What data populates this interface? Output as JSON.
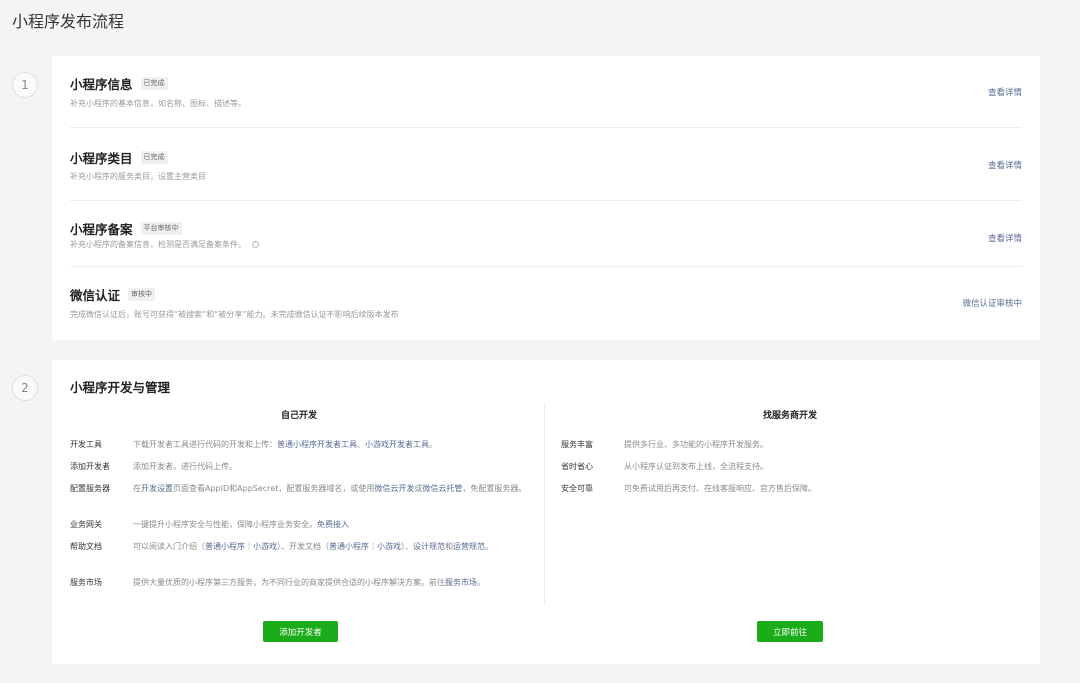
{
  "page_title": "小程序发布流程",
  "steps": [
    "1",
    "2"
  ],
  "section1": {
    "rows": [
      {
        "title": "小程序信息",
        "badge": "已完成",
        "desc": "补充小程序的基本信息，如名称、图标、描述等。",
        "link": "查看详情"
      },
      {
        "title": "小程序类目",
        "badge": "已完成",
        "desc": "补充小程序的服务类目，设置主营类目",
        "link": "查看详情"
      },
      {
        "title": "小程序备案",
        "badge": "平台审核中",
        "desc": "补充小程序的备案信息，检测是否满足备案条件。",
        "link": "查看详情"
      },
      {
        "title": "微信认证",
        "badge": "审核中",
        "desc": "完成微信认证后，账号可获得“被搜索”和“被分享”能力。未完成微信认证不影响后续版本发布",
        "link": "微信认证审核中"
      }
    ]
  },
  "section2": {
    "title": "小程序开发与管理",
    "left": {
      "title": "自己开发",
      "items": {
        "tools": {
          "label": "开发工具",
          "t1": "下载开发者工具进行代码的开发和上传：",
          "l1": "普通小程序开发者工具",
          "t2": "、",
          "l2": "小游戏开发者工具",
          "t3": "。"
        },
        "dev": {
          "label": "添加开发者",
          "t1": "添加开发者，进行代码上传。"
        },
        "server": {
          "label": "配置服务器",
          "t1": "在",
          "l1": "开发设置",
          "t2": "页面查看AppID和AppSecret，配置服务器域名，或使用",
          "l2": "微信云开发",
          "t3": "或",
          "l3": "微信云托管",
          "t4": "，免配置服务器。"
        },
        "gateway": {
          "label": "业务网关",
          "t1": "一键提升小程序安全与性能，保障小程序业务安全。",
          "l1": "免费接入"
        },
        "docs": {
          "label": "帮助文档",
          "t1": "可以阅读入门介绍（",
          "l1": "普通小程序",
          "t2": "｜",
          "l2": "小游戏",
          "t3": "）、开发文档（",
          "l3": "普通小程序",
          "t4": "｜",
          "l4": "小游戏",
          "t5": "）、",
          "l5": "设计规范",
          "t6": "和",
          "l6": "运营规范",
          "t7": "。"
        },
        "market": {
          "label": "服务市场",
          "t1": "提供大量优质的小程序第三方服务，为不同行业的商家提供合适的小程序解决方案。前往",
          "l1": "服务市场",
          "t2": "。"
        }
      },
      "button": "添加开发者"
    },
    "right": {
      "title": "找服务商开发",
      "items": [
        {
          "label": "服务丰富",
          "text": "提供多行业、多功能的小程序开发服务。"
        },
        {
          "label": "省时省心",
          "text": "从小程序认证到发布上线，全流程支持。"
        },
        {
          "label": "安全可靠",
          "text": "可免费试用后再支付、在线客服响应、官方售后保障。"
        }
      ],
      "button": "立即前往"
    }
  },
  "colors": {
    "link": "#576b95",
    "button": "#1aad19"
  }
}
